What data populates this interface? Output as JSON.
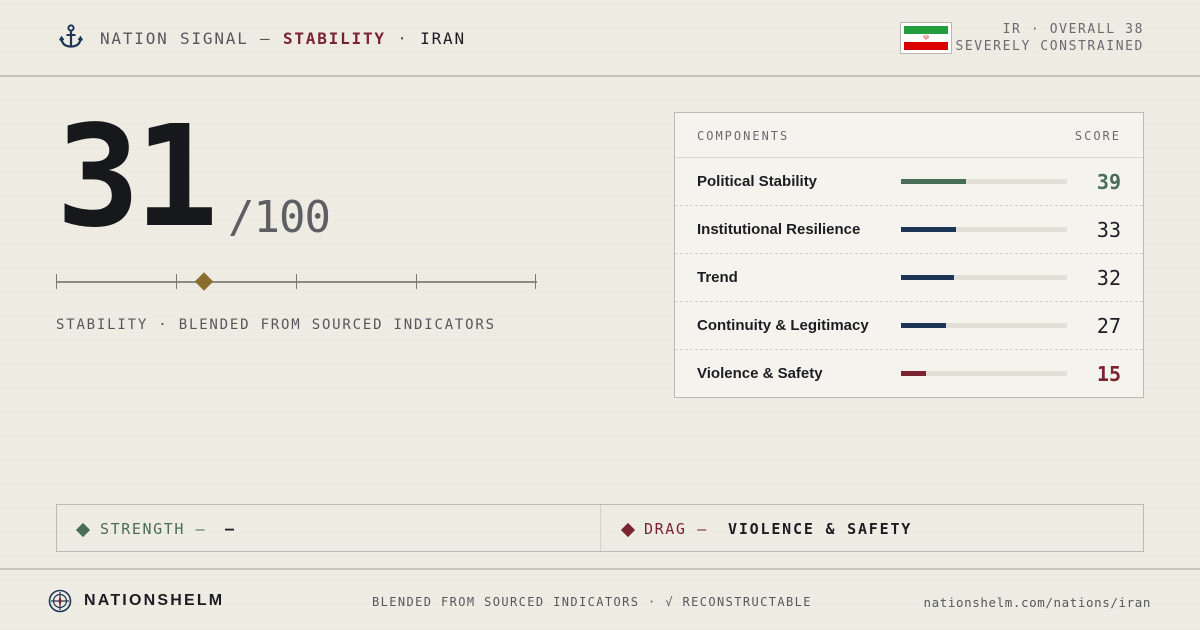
{
  "header": {
    "brand_prefix": "NATION SIGNAL — ",
    "section": "STABILITY",
    "separator": " · ",
    "country": "IRAN",
    "meta_line1": "IR · OVERALL 38",
    "meta_line2": "SEVERELY CONSTRAINED",
    "flag_colors": [
      "#239f40",
      "#ffffff",
      "#da0000"
    ],
    "icon": "anchor-icon"
  },
  "score": {
    "value": "31",
    "denominator": "/100",
    "scale_position": 0.31,
    "caption": "STABILITY · BLENDED FROM SOURCED INDICATORS"
  },
  "components": {
    "header_left": "COMPONENTS",
    "header_right": "SCORE",
    "rows": [
      {
        "label": "Political Stability",
        "score": "39",
        "fraction": 0.39,
        "bar_color": "#4a6d57",
        "score_color": "#4a6d57",
        "emphasis": true
      },
      {
        "label": "Institutional Resilience",
        "score": "33",
        "fraction": 0.33,
        "bar_color": "#1d3657",
        "score_color": "#1c1d22",
        "emphasis": false
      },
      {
        "label": "Trend",
        "score": "32",
        "fraction": 0.32,
        "bar_color": "#1d3657",
        "score_color": "#1c1d22",
        "emphasis": false
      },
      {
        "label": "Continuity & Legitimacy",
        "score": "27",
        "fraction": 0.27,
        "bar_color": "#1d3657",
        "score_color": "#1c1d22",
        "emphasis": false
      },
      {
        "label": "Violence & Safety",
        "score": "15",
        "fraction": 0.15,
        "bar_color": "#7a2331",
        "score_color": "#7a2331",
        "emphasis": true
      }
    ]
  },
  "strength_drag": {
    "strength_label": "STRENGTH —",
    "strength_value": "—",
    "strength_color": "#4a6d57",
    "drag_label": "DRAG —",
    "drag_value": "VIOLENCE & SAFETY",
    "drag_color": "#7a2331"
  },
  "footer": {
    "brand": "NATIONSHELM",
    "tagline": "BLENDED FROM SOURCED INDICATORS · √ RECONSTRUCTABLE",
    "url": "nationshelm.com/nations/iran",
    "icon": "helm-compass-icon"
  }
}
